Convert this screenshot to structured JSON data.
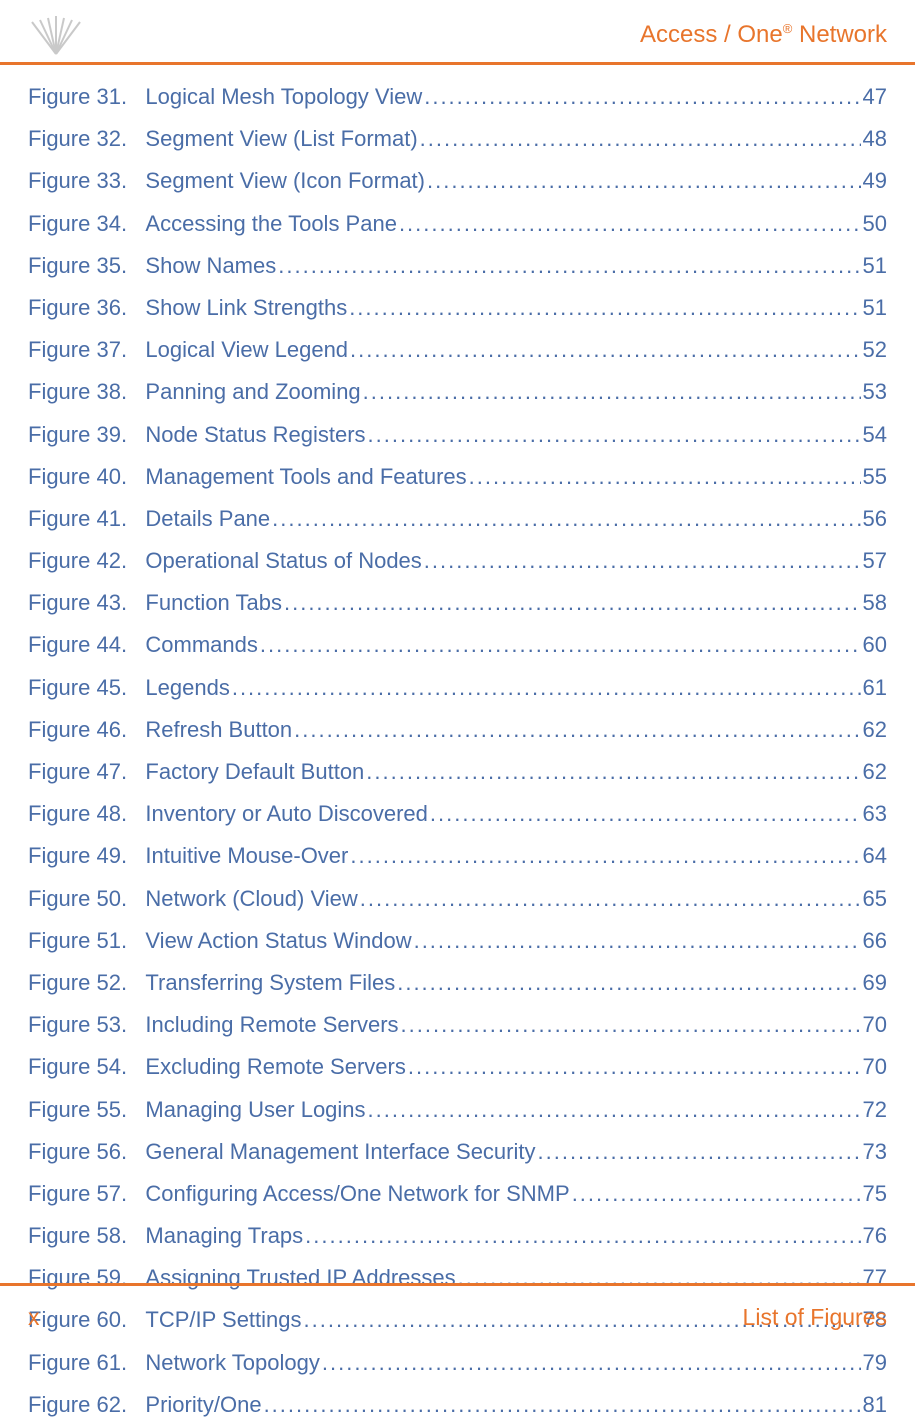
{
  "header": {
    "brand_part1": "Access / One",
    "brand_reg": "®",
    "brand_part2": " Network"
  },
  "entries": [
    {
      "label": "Figure 31.",
      "title": "Logical Mesh Topology View",
      "page": "47"
    },
    {
      "label": "Figure 32.",
      "title": "Segment View (List Format)",
      "page": "48"
    },
    {
      "label": "Figure 33.",
      "title": "Segment View (Icon Format)",
      "page": "49"
    },
    {
      "label": "Figure 34.",
      "title": "Accessing the Tools Pane",
      "page": "50"
    },
    {
      "label": "Figure 35.",
      "title": "Show Names",
      "page": "51"
    },
    {
      "label": "Figure 36.",
      "title": "Show Link Strengths",
      "page": "51"
    },
    {
      "label": "Figure 37.",
      "title": "Logical View Legend",
      "page": "52"
    },
    {
      "label": "Figure 38.",
      "title": "Panning and Zooming",
      "page": "53"
    },
    {
      "label": "Figure 39.",
      "title": "Node Status Registers",
      "page": "54"
    },
    {
      "label": "Figure 40.",
      "title": "Management Tools and Features",
      "page": "55"
    },
    {
      "label": "Figure 41.",
      "title": "Details Pane",
      "page": "56"
    },
    {
      "label": "Figure 42.",
      "title": "Operational Status of Nodes",
      "page": "57"
    },
    {
      "label": "Figure 43.",
      "title": "Function Tabs",
      "page": "58"
    },
    {
      "label": "Figure 44.",
      "title": "Commands",
      "page": "60"
    },
    {
      "label": "Figure 45.",
      "title": "Legends",
      "page": "61"
    },
    {
      "label": "Figure 46.",
      "title": "Refresh Button",
      "page": "62"
    },
    {
      "label": "Figure 47.",
      "title": "Factory Default Button",
      "page": "62"
    },
    {
      "label": "Figure 48.",
      "title": "Inventory or Auto Discovered",
      "page": "63"
    },
    {
      "label": "Figure 49.",
      "title": "Intuitive Mouse-Over",
      "page": "64"
    },
    {
      "label": "Figure 50.",
      "title": "Network (Cloud) View",
      "page": "65"
    },
    {
      "label": "Figure 51.",
      "title": "View Action Status Window",
      "page": "66"
    },
    {
      "label": "Figure 52.",
      "title": "Transferring System Files",
      "page": "69"
    },
    {
      "label": "Figure 53.",
      "title": "Including Remote Servers",
      "page": "70"
    },
    {
      "label": "Figure 54.",
      "title": "Excluding Remote Servers",
      "page": "70"
    },
    {
      "label": "Figure 55.",
      "title": "Managing User Logins",
      "page": "72"
    },
    {
      "label": "Figure 56.",
      "title": "General Management Interface Security",
      "page": "73"
    },
    {
      "label": "Figure 57.",
      "title": "Configuring Access/One Network for SNMP",
      "page": "75"
    },
    {
      "label": "Figure 58.",
      "title": "Managing Traps",
      "page": "76"
    },
    {
      "label": "Figure 59.",
      "title": "Assigning Trusted IP Addresses",
      "page": "77"
    },
    {
      "label": "Figure 60.",
      "title": "TCP/IP Settings",
      "page": "78"
    },
    {
      "label": "Figure 61.",
      "title": "Network Topology",
      "page": "79"
    },
    {
      "label": "Figure 62.",
      "title": "Priority/One",
      "page": "81"
    }
  ],
  "footer": {
    "page_number": "x",
    "section_title": "List of Figures"
  }
}
